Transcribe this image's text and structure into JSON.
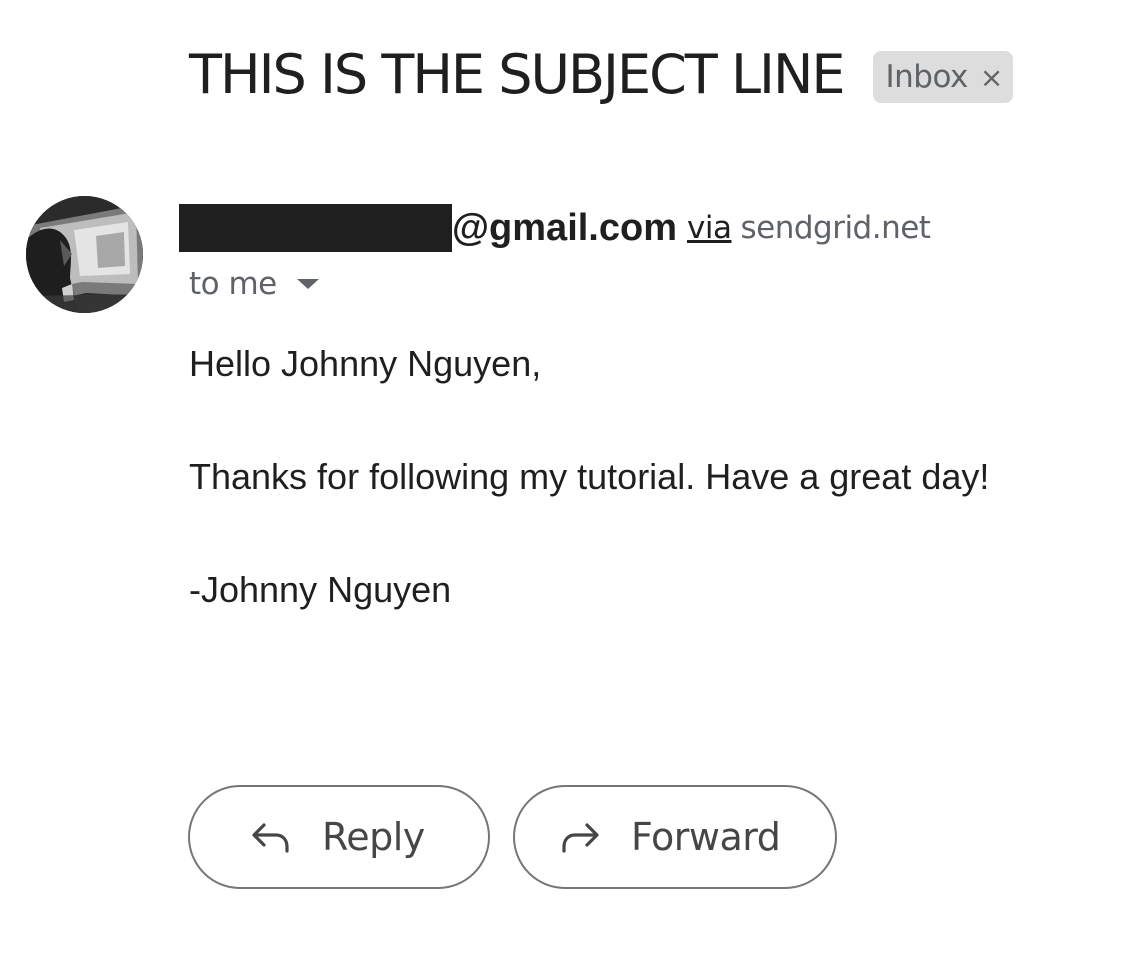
{
  "email": {
    "subject": "THIS IS THE SUBJECT LINE",
    "label": "Inbox",
    "label_close": "×",
    "sender": {
      "email_domain": "@gmail.com",
      "via_text": "via",
      "via_domain": "sendgrid.net"
    },
    "recipient_text": "to me",
    "body": [
      "Hello Johnny Nguyen,",
      "Thanks for following my tutorial. Have a great day!",
      "-Johnny Nguyen"
    ]
  },
  "actions": {
    "reply_label": "Reply",
    "forward_label": "Forward",
    "reply_icon": "reply-arrow-icon",
    "forward_icon": "forward-arrow-icon"
  },
  "colors": {
    "text": "#1f1f1f",
    "secondary_text": "#5f6368",
    "chip_background": "#dddddd",
    "button_border": "#747775"
  }
}
